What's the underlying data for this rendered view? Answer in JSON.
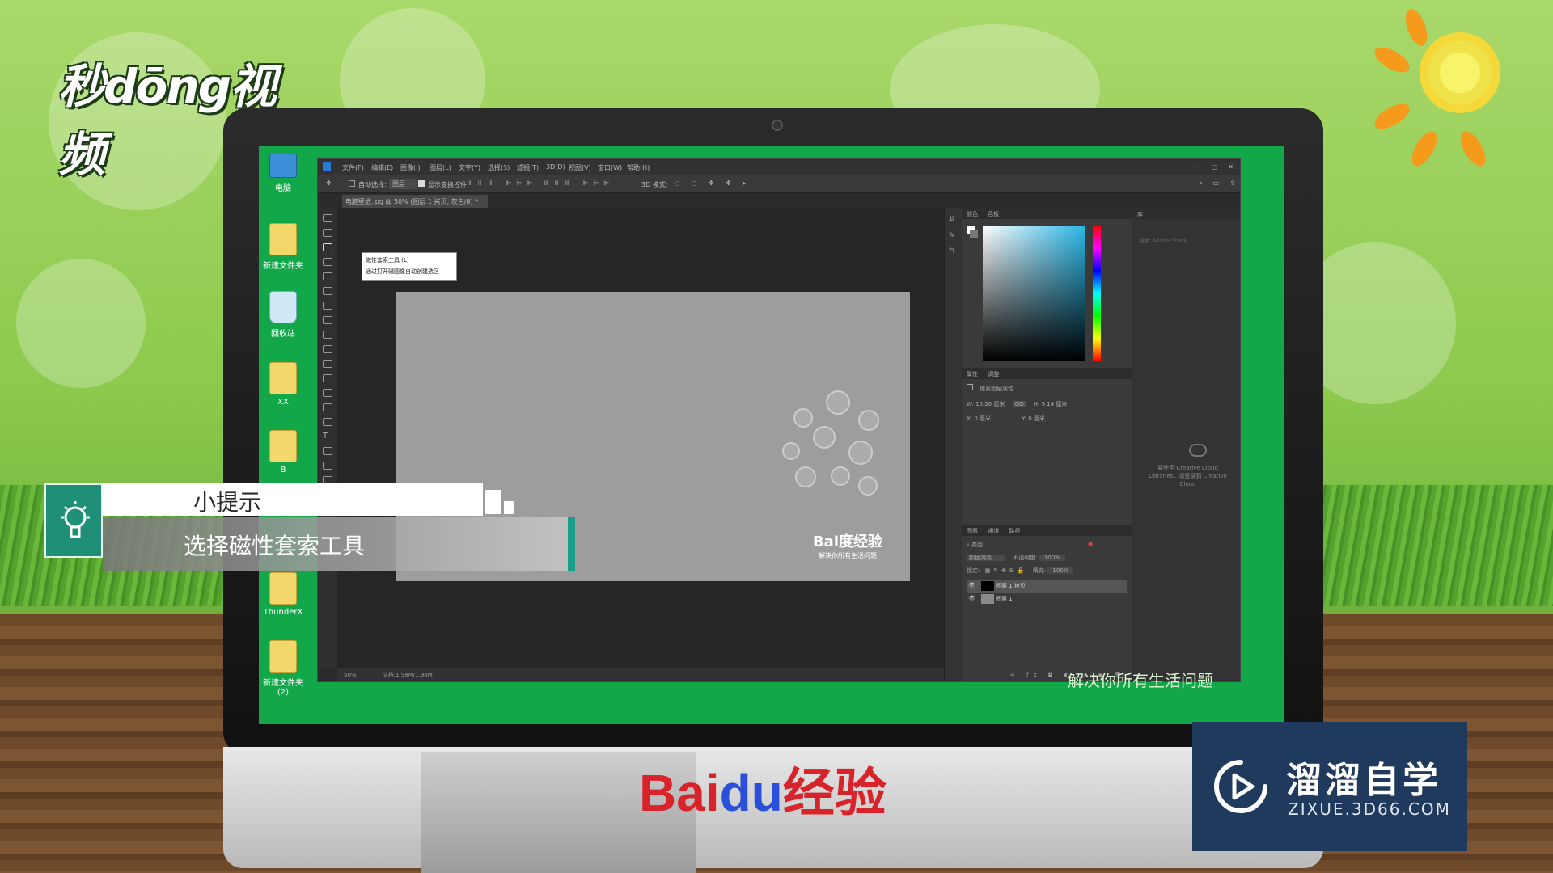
{
  "brand": {
    "logo_text": "秒dōng视频"
  },
  "desktop_icons": [
    {
      "label": "电脑"
    },
    {
      "label": "新建文件夹"
    },
    {
      "label": "回收站"
    },
    {
      "label": "XX"
    },
    {
      "label": "B"
    },
    {
      "label": "ThunderX"
    },
    {
      "label": "新建文件夹 (2)"
    }
  ],
  "photoshop": {
    "menus": [
      "文件(F)",
      "编辑(E)",
      "图像(I)",
      "图层(L)",
      "文字(Y)",
      "选择(S)",
      "滤镜(T)",
      "3D(D)",
      "视图(V)",
      "窗口(W)",
      "帮助(H)"
    ],
    "options": {
      "auto_select": "自动选择:",
      "layer_select": "图层",
      "show_transform": "显示变换控件",
      "mode3d": "3D 模式:"
    },
    "doc_tab": "电脑壁纸.jpg @ 50% (图层 1 拷贝, 灰色/8) *",
    "tooltip": {
      "title": "磁性套索工具 (L)",
      "desc": "通过打开磁图像自动创建选区"
    },
    "canvas_logo": {
      "name": "Bai度经验",
      "slogan": "解决你所有生活问题"
    },
    "status": {
      "zoom": "50%",
      "doc": "文档:1.98M/1.98M"
    },
    "panels": {
      "color_tabs": [
        "颜色",
        "色板"
      ],
      "props_tabs": [
        "属性",
        "调整"
      ],
      "props_title": "像素图层属性",
      "props": {
        "w": "W: 16.26 厘米",
        "h": "H: 9.14 厘米",
        "x": "X: 0 厘米",
        "y": "Y: 0 厘米",
        "link": "GO"
      },
      "layers_tabs": [
        "图层",
        "通道",
        "路径"
      ],
      "layer_kind": "类型",
      "blend": "颜色减淡",
      "opacity_label": "不透明度:",
      "opacity": "100%",
      "lock_label": "锁定:",
      "fill_label": "填充:",
      "fill": "100%",
      "layers": [
        {
          "name": "图层 1 拷贝"
        },
        {
          "name": "图层 1"
        }
      ],
      "libs_tab": "库",
      "libs_search": "搜索 Adobe Stock",
      "libs_msg": "要使用 Creative Cloud Libraries，请登录到 Creative Cloud"
    }
  },
  "screen_caption": "解决你所有生活问题",
  "tip": {
    "title": "小提示",
    "body": "选择磁性套索工具"
  },
  "monitor_brand": {
    "a": "Bai",
    "b": "du",
    "c": "经验"
  },
  "watermark": {
    "name": "溜溜自学",
    "url": "ZIXUE.3D66.COM"
  },
  "colors": {
    "screen_green": "#12a84a",
    "tip_teal": "#1f8f78",
    "watermark_bg": "#1f3a5d",
    "baidu_red": "#d9232b",
    "baidu_blue": "#2a4fd8"
  }
}
